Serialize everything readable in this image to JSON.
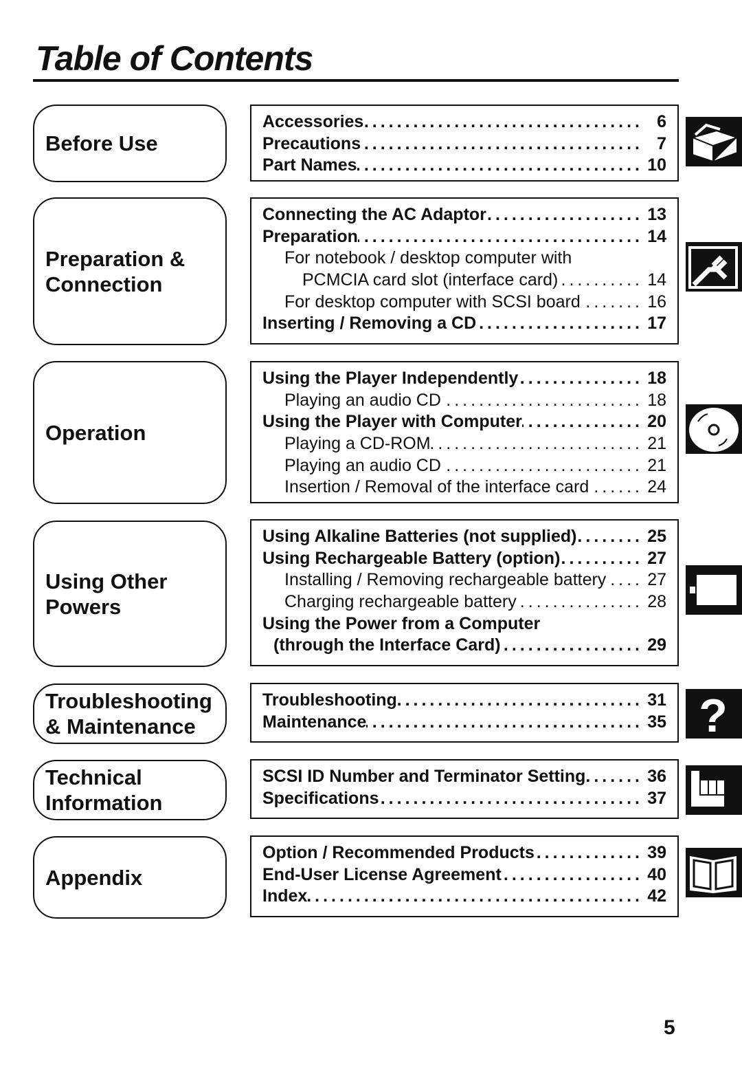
{
  "title": "Table of Contents",
  "page_number": "5",
  "sections": [
    {
      "heading": [
        "Before Use"
      ],
      "icon": "open-box-icon",
      "entries": [
        {
          "text": "Accessories",
          "page": "6",
          "style": "b"
        },
        {
          "text": "Precautions",
          "page": "7",
          "style": "b"
        },
        {
          "text": "Part Names",
          "page": "10",
          "style": "b"
        }
      ]
    },
    {
      "heading": [
        "Preparation &",
        "Connection"
      ],
      "icon": "plug-icon",
      "entries": [
        {
          "text": "Connecting the AC Adaptor",
          "page": "13",
          "style": "b"
        },
        {
          "text": "Preparation",
          "page": "14",
          "style": "b"
        },
        {
          "text": "For notebook / desktop computer with",
          "page": "",
          "style": "s"
        },
        {
          "text": "PCMCIA card slot (interface card)",
          "page": "14",
          "style": "ss"
        },
        {
          "text": "For desktop computer with SCSI board",
          "page": "16",
          "style": "s"
        },
        {
          "text": "Inserting / Removing a CD",
          "page": "17",
          "style": "b"
        }
      ]
    },
    {
      "heading": [
        "Operation"
      ],
      "icon": "cd-icon",
      "entries": [
        {
          "text": "Using the Player Independently",
          "page": "18",
          "style": "b"
        },
        {
          "text": "Playing an audio CD",
          "page": "18",
          "style": "s"
        },
        {
          "text": "Using the Player with Computer",
          "page": "20",
          "style": "b"
        },
        {
          "text": "Playing a CD-ROM",
          "page": "21",
          "style": "s"
        },
        {
          "text": "Playing an audio CD",
          "page": "21",
          "style": "s"
        },
        {
          "text": "Insertion / Removal of the interface card",
          "page": "24",
          "style": "s"
        }
      ]
    },
    {
      "heading": [
        "Using Other",
        "Powers"
      ],
      "icon": "battery-icon",
      "entries": [
        {
          "text": "Using Alkaline Batteries (not supplied)",
          "page": "25",
          "style": "b"
        },
        {
          "text": "Using Rechargeable Battery (option)",
          "page": "27",
          "style": "b"
        },
        {
          "text": "Installing / Removing rechargeable battery",
          "page": "27",
          "style": "s"
        },
        {
          "text": "Charging rechargeable battery",
          "page": "28",
          "style": "s"
        },
        {
          "text": "Using the Power from a Computer",
          "page": "",
          "style": "b"
        },
        {
          "text": "(through the Interface Card)",
          "page": "29",
          "style": "bs"
        }
      ]
    },
    {
      "heading": [
        "Troubleshooting",
        "&  Maintenance"
      ],
      "icon": "question-mark-icon",
      "entries": [
        {
          "text": "Troubleshooting",
          "page": "31",
          "style": "b"
        },
        {
          "text": "Maintenance",
          "page": "35",
          "style": "b"
        }
      ]
    },
    {
      "heading": [
        "Technical",
        "Information"
      ],
      "icon": "hand-pointing-icon",
      "entries": [
        {
          "text": "SCSI ID Number and Terminator Setting",
          "page": "36",
          "style": "b"
        },
        {
          "text": "Specifications",
          "page": "37",
          "style": "b"
        }
      ]
    },
    {
      "heading": [
        "Appendix"
      ],
      "icon": "open-book-icon",
      "entries": [
        {
          "text": "Option / Recommended Products",
          "page": "39",
          "style": "b"
        },
        {
          "text": "End-User License Agreement",
          "page": "40",
          "style": "b"
        },
        {
          "text": "Index",
          "page": "42",
          "style": "b"
        }
      ]
    }
  ]
}
